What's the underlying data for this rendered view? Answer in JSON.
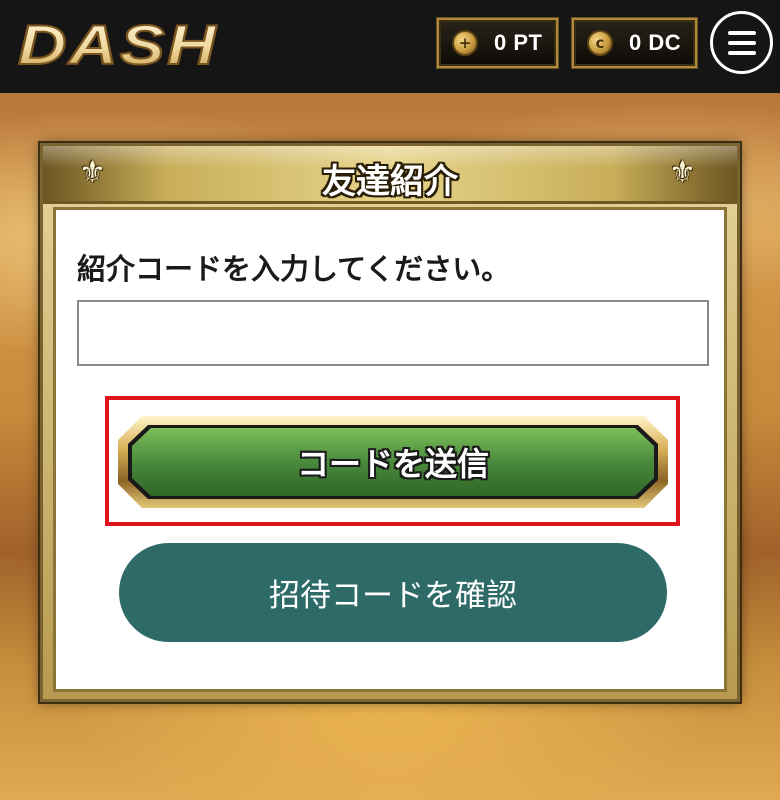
{
  "header": {
    "logo_text": "DASH",
    "pt": {
      "value": "0 PT",
      "icon": "plus-coin-icon"
    },
    "dc": {
      "value": "0 DC",
      "icon": "dc-coin-icon"
    },
    "menu_icon": "hamburger-icon"
  },
  "panel": {
    "title": "友達紹介",
    "prompt": "紹介コードを入力してください。",
    "input_value": "",
    "input_placeholder": "",
    "send_button_label": "コードを送信",
    "confirm_button_label": "招待コードを確認"
  },
  "colors": {
    "header_bg": "#151515",
    "send_button_green": "#4a8a3c",
    "confirm_button_teal": "#2e6b68",
    "highlight_red": "#e0141c",
    "gold": "#c9ae5a"
  }
}
